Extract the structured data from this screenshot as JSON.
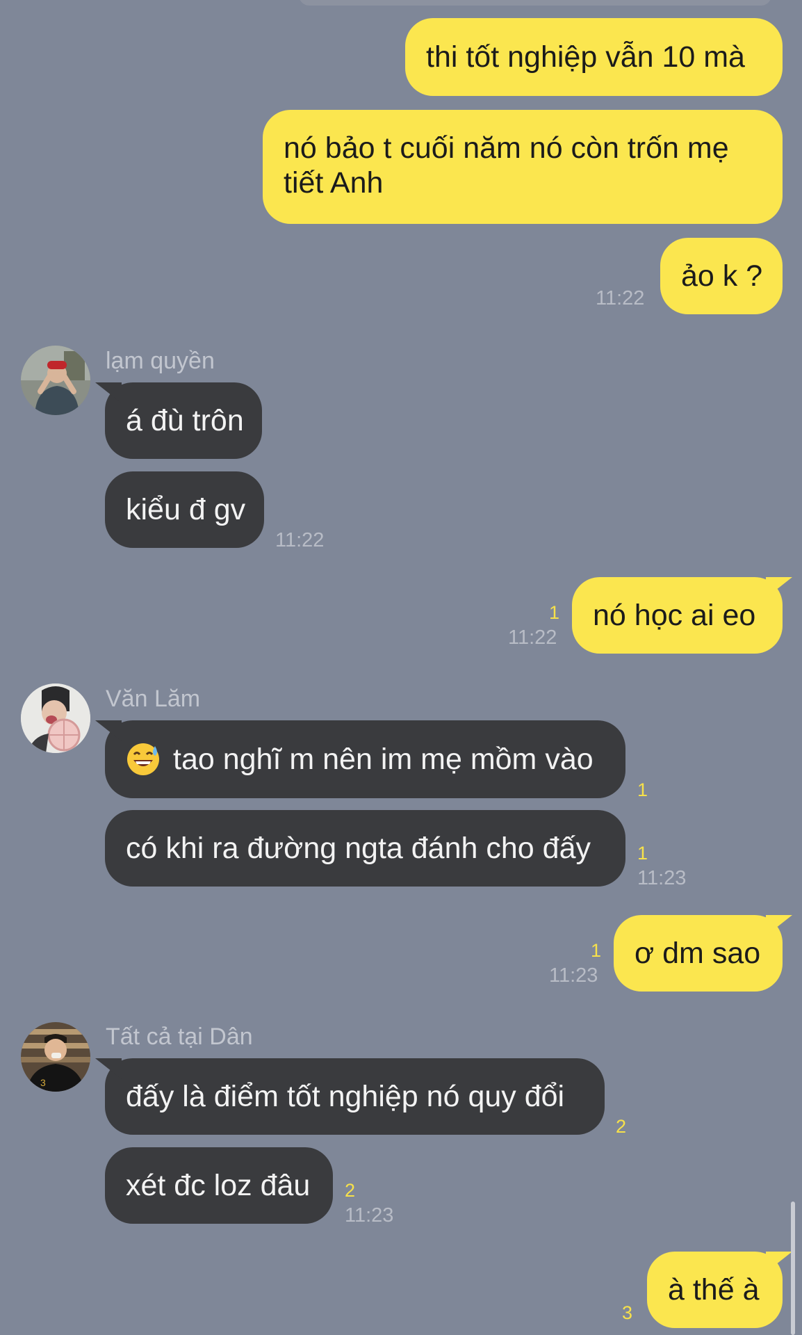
{
  "colors": {
    "background": "#7f8798",
    "outgoing_bubble": "#fbe64f",
    "incoming_bubble": "#3a3b3e",
    "unread_count": "#f7e14a",
    "timestamp": "#b8bcc6"
  },
  "messages": {
    "m1": {
      "text": "thi tốt nghiệp vẫn 10 mà"
    },
    "m2": {
      "text": "nó bảo t cuối năm nó còn trốn mẹ tiết Anh"
    },
    "m3": {
      "text": "ảo k ?",
      "time": "11:22"
    },
    "g1": {
      "sender": "lạm quyền",
      "avatar_icon": "person-in-red-cap-avatar",
      "m4": {
        "text": "á đù trôn"
      },
      "m5": {
        "text": "kiểu đ gv",
        "time": "11:22"
      }
    },
    "m6": {
      "text": "nó học ai eo",
      "unread": "1",
      "time": "11:22"
    },
    "g2": {
      "sender": "Văn Lăm",
      "avatar_icon": "person-with-fan-avatar",
      "m7": {
        "emoji": "grinning-sweat-emoji",
        "text": "tao nghĩ m nên im mẹ mồm vào",
        "unread": "1"
      },
      "m8": {
        "text": "có khi ra đường ngta đánh cho đấy",
        "unread": "1",
        "time": "11:23"
      }
    },
    "m9": {
      "text": "ơ dm sao",
      "unread": "1",
      "time": "11:23"
    },
    "g3": {
      "sender": "Tất cả tại Dân",
      "avatar_icon": "person-in-dark-shirt-avatar",
      "m10": {
        "text": "đấy là điểm tốt nghiệp nó quy đổi",
        "unread": "2"
      },
      "m11": {
        "text": "xét đc loz đâu",
        "unread": "2",
        "time": "11:23"
      }
    },
    "m12": {
      "text": "à thế à",
      "unread": "3"
    }
  }
}
